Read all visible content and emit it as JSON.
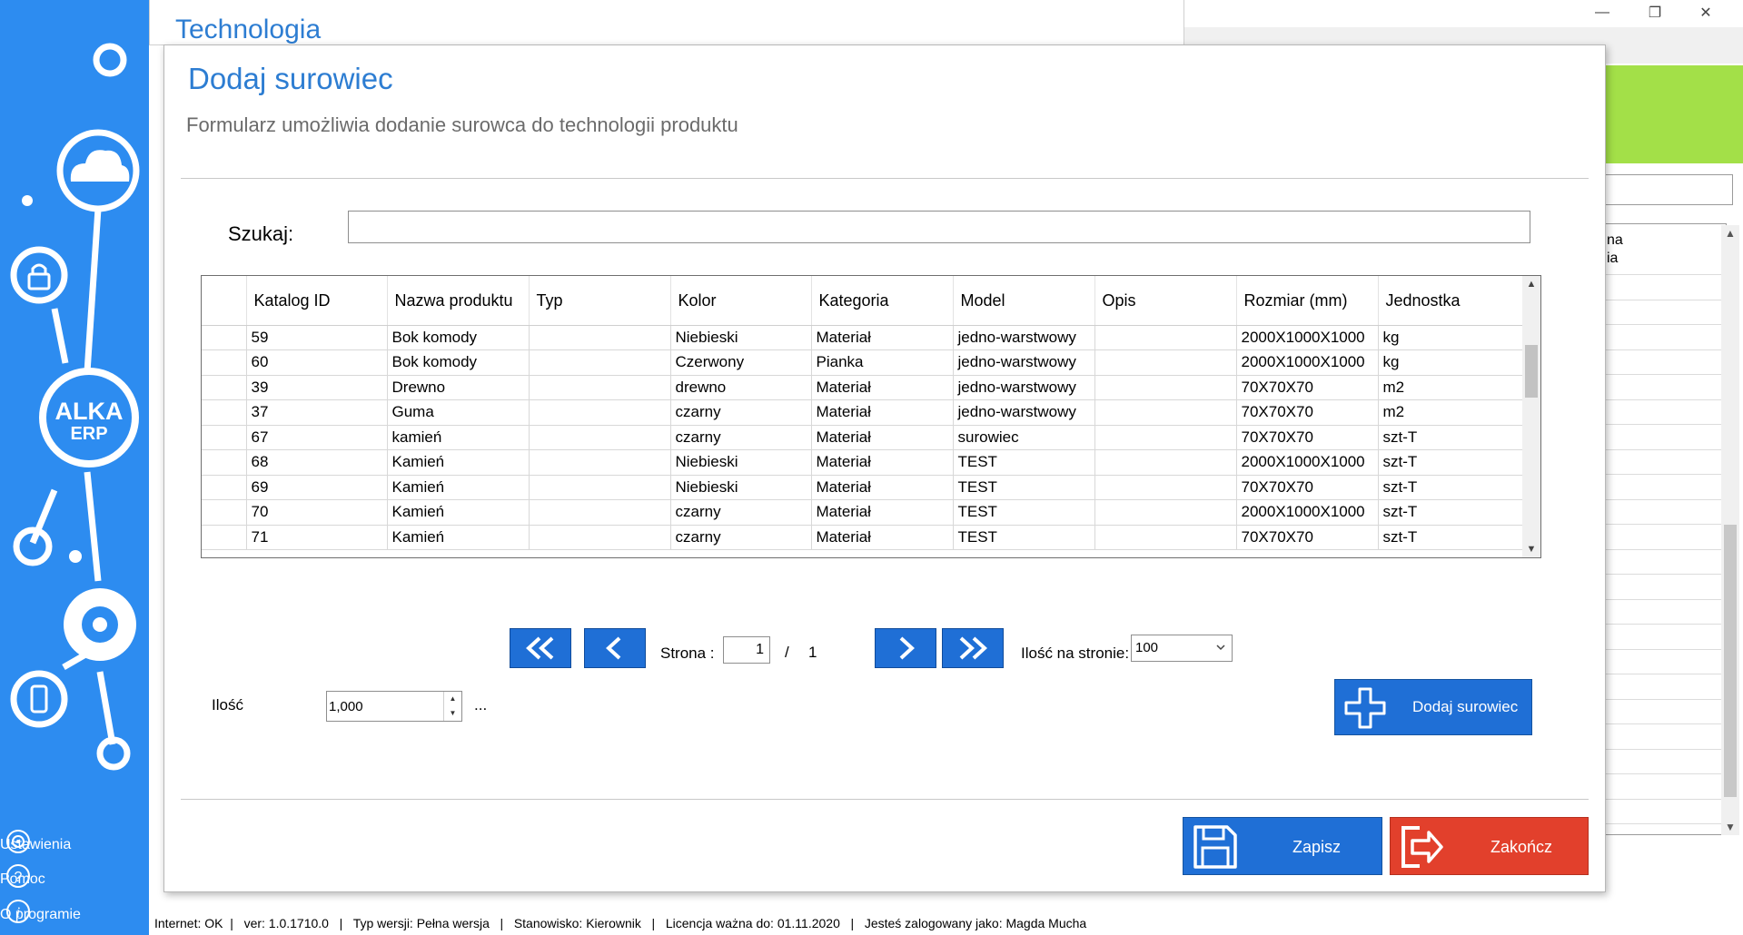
{
  "window": {
    "background_title": "Technologia",
    "controls": {
      "minimize": "—",
      "restore": "❐",
      "close": "✕"
    },
    "bg_grid_header": [
      "na",
      "ia"
    ]
  },
  "sidebar": {
    "logo_line1": "ALKA",
    "logo_line2": "ERP",
    "menu": [
      {
        "label": "Ustawienia",
        "icon": "gear-icon"
      },
      {
        "label": "Pomoc",
        "icon": "help-icon"
      },
      {
        "label": "O programie",
        "icon": "info-icon"
      }
    ]
  },
  "dialog": {
    "title": "Dodaj surowiec",
    "subtitle": "Formularz umożliwia dodanie surowca do technologii produktu",
    "search": {
      "label": "Szukaj:",
      "value": "",
      "placeholder": ""
    },
    "grid": {
      "columns": [
        {
          "label": ""
        },
        {
          "label": "Katalog ID"
        },
        {
          "label": "Nazwa produktu"
        },
        {
          "label": "Typ"
        },
        {
          "label": "Kolor"
        },
        {
          "label": "Kategoria"
        },
        {
          "label": "Model"
        },
        {
          "label": "Opis"
        },
        {
          "label": "Rozmiar (mm)"
        },
        {
          "label": "Jednostka"
        }
      ],
      "rows": [
        [
          "",
          "59",
          "Bok komody",
          "",
          "Niebieski",
          "Materiał",
          "jedno-warstwowy",
          "",
          "2000X1000X1000",
          "kg"
        ],
        [
          "",
          "60",
          "Bok komody",
          "",
          "Czerwony",
          "Pianka",
          "jedno-warstwowy",
          "",
          "2000X1000X1000",
          "kg"
        ],
        [
          "",
          "39",
          "Drewno",
          "",
          "drewno",
          "Materiał",
          "jedno-warstwowy",
          "",
          "70X70X70",
          "m2"
        ],
        [
          "",
          "37",
          "Guma",
          "",
          "czarny",
          "Materiał",
          "jedno-warstwowy",
          "",
          "70X70X70",
          "m2"
        ],
        [
          "",
          "67",
          "kamień",
          "",
          "czarny",
          "Materiał",
          "surowiec",
          "",
          "70X70X70",
          "szt-T"
        ],
        [
          "",
          "68",
          "Kamień",
          "",
          "Niebieski",
          "Materiał",
          "TEST",
          "",
          "2000X1000X1000",
          "szt-T"
        ],
        [
          "",
          "69",
          "Kamień",
          "",
          "Niebieski",
          "Materiał",
          "TEST",
          "",
          "70X70X70",
          "szt-T"
        ],
        [
          "",
          "70",
          "Kamień",
          "",
          "czarny",
          "Materiał",
          "TEST",
          "",
          "2000X1000X1000",
          "szt-T"
        ],
        [
          "",
          "71",
          "Kamień",
          "",
          "czarny",
          "Materiał",
          "TEST",
          "",
          "70X70X70",
          "szt-T"
        ]
      ]
    },
    "pager": {
      "page_label": "Strona :",
      "current_page": "1",
      "separator": "/",
      "total_pages": "1",
      "per_page_label": "Ilość na stronie:",
      "per_page_value": "100"
    },
    "quantity": {
      "label": "Ilość",
      "value": "1,000",
      "more": "..."
    },
    "buttons": {
      "add": "Dodaj surowiec",
      "save": "Zapisz",
      "exit": "Zakończ"
    }
  },
  "statusbar": {
    "text": "Internet: OK  |   ver: 1.0.1710.0   |   Typ wersji: Pełna wersja   |   Stanowisko: Kierownik   |   Licencja ważna do: 01.11.2020   |   Jesteś zalogowany jako: Magda Mucha"
  },
  "colors": {
    "sidebar": "#2d8cf0",
    "title_blue": "#2d7dd2",
    "button_blue": "#1f6fd6",
    "button_red": "#e2402c",
    "accent_green": "#a3e048"
  }
}
